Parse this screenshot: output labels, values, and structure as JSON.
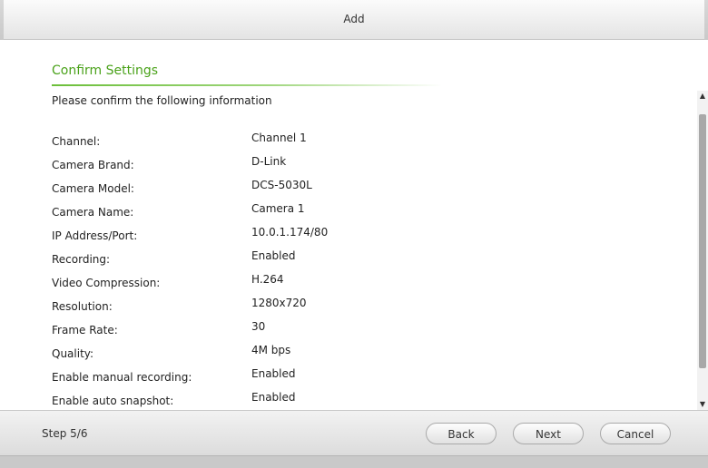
{
  "window": {
    "title": "Add"
  },
  "section": {
    "title": "Confirm Settings",
    "intro": "Please confirm the following information"
  },
  "settings": [
    {
      "label": "Channel:",
      "value": "Channel 1"
    },
    {
      "label": "Camera Brand:",
      "value": "D-Link"
    },
    {
      "label": "Camera Model:",
      "value": "DCS-5030L"
    },
    {
      "label": "Camera Name:",
      "value": "Camera 1"
    },
    {
      "label": "IP Address/Port:",
      "value": "10.0.1.174/80"
    },
    {
      "label": "Recording:",
      "value": "Enabled"
    },
    {
      "label": "Video Compression:",
      "value": "H.264"
    },
    {
      "label": "Resolution:",
      "value": "1280x720"
    },
    {
      "label": "Frame Rate:",
      "value": "30"
    },
    {
      "label": "Quality:",
      "value": "4M bps"
    },
    {
      "label": "Enable manual recording:",
      "value": "Enabled"
    },
    {
      "label": "Enable auto snapshot:",
      "value": "Enabled"
    }
  ],
  "footer": {
    "step": "Step 5/6",
    "back_label": "Back",
    "next_label": "Next",
    "cancel_label": "Cancel"
  },
  "scrollbar": {
    "up_icon": "scroll-up-arrow-icon",
    "down_icon": "scroll-down-arrow-icon"
  },
  "colors": {
    "accent": "#4aa21a"
  }
}
